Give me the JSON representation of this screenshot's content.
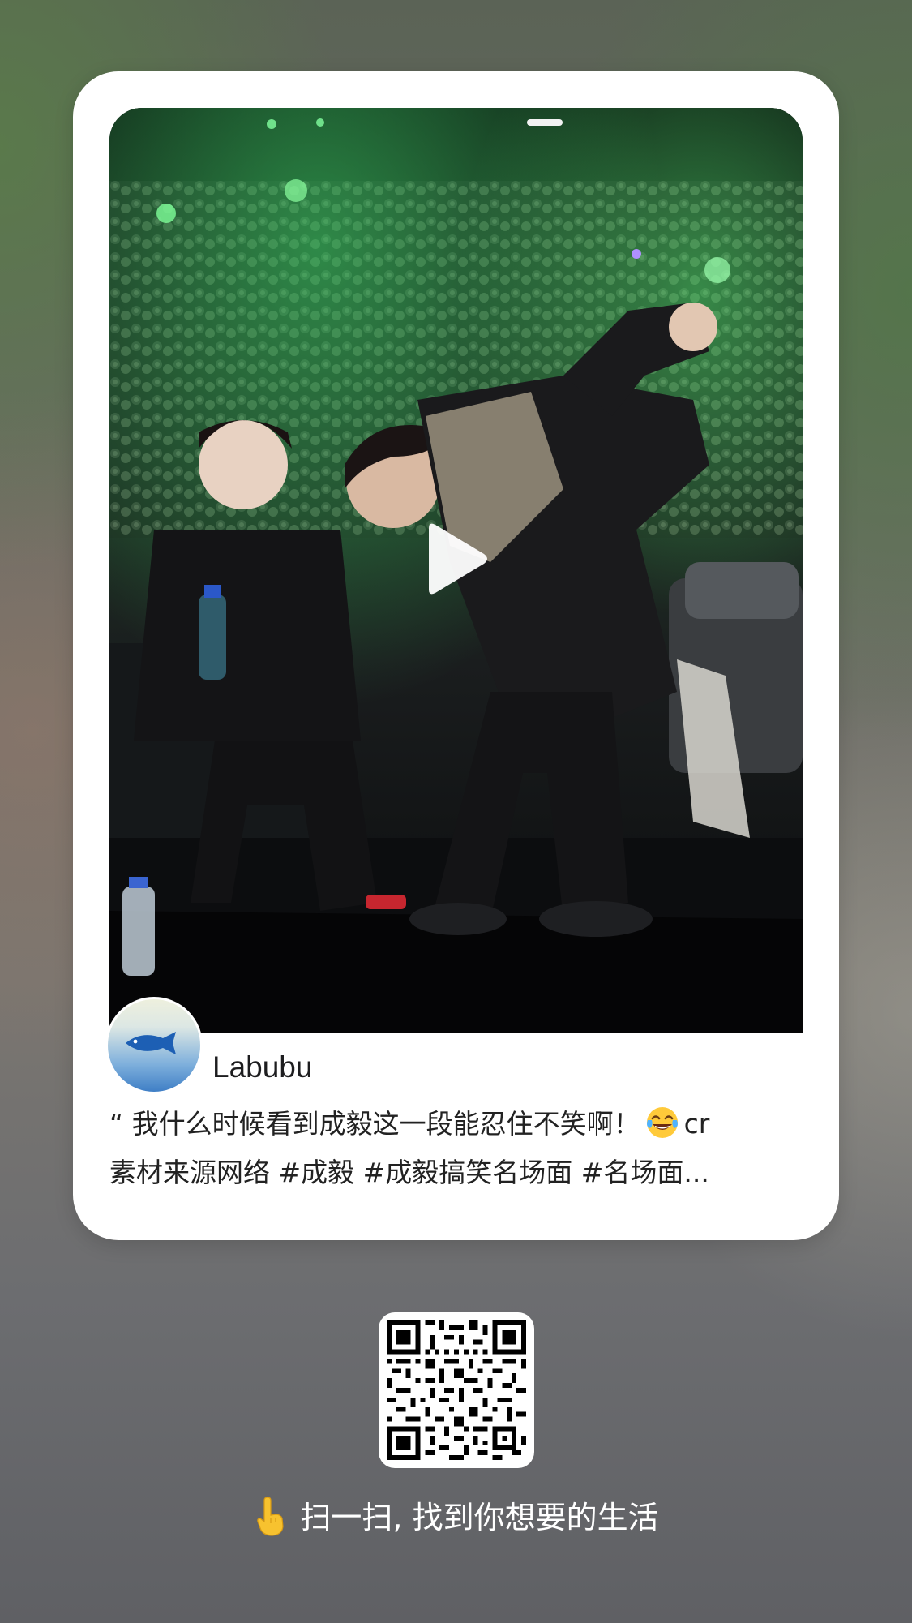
{
  "post": {
    "username": "Labubu",
    "caption_line1_start": "“ 我什么时候看到成毅这一段能忍住不笑啊！",
    "caption_line1_end": "cr",
    "caption_line2": "素材来源网络 #成毅  #成毅搞笑名场面  #名场面...",
    "emoji": "face-with-tears-of-joy-icon",
    "video_state": "paused"
  },
  "share": {
    "tagline": "扫一扫, 找到你想要的生活",
    "tagline_icon": "pointing-up-hand-icon"
  },
  "colors": {
    "card_background": "#ffffff",
    "text_primary": "#1d1d1f",
    "tagline_text": "#ffffff"
  }
}
